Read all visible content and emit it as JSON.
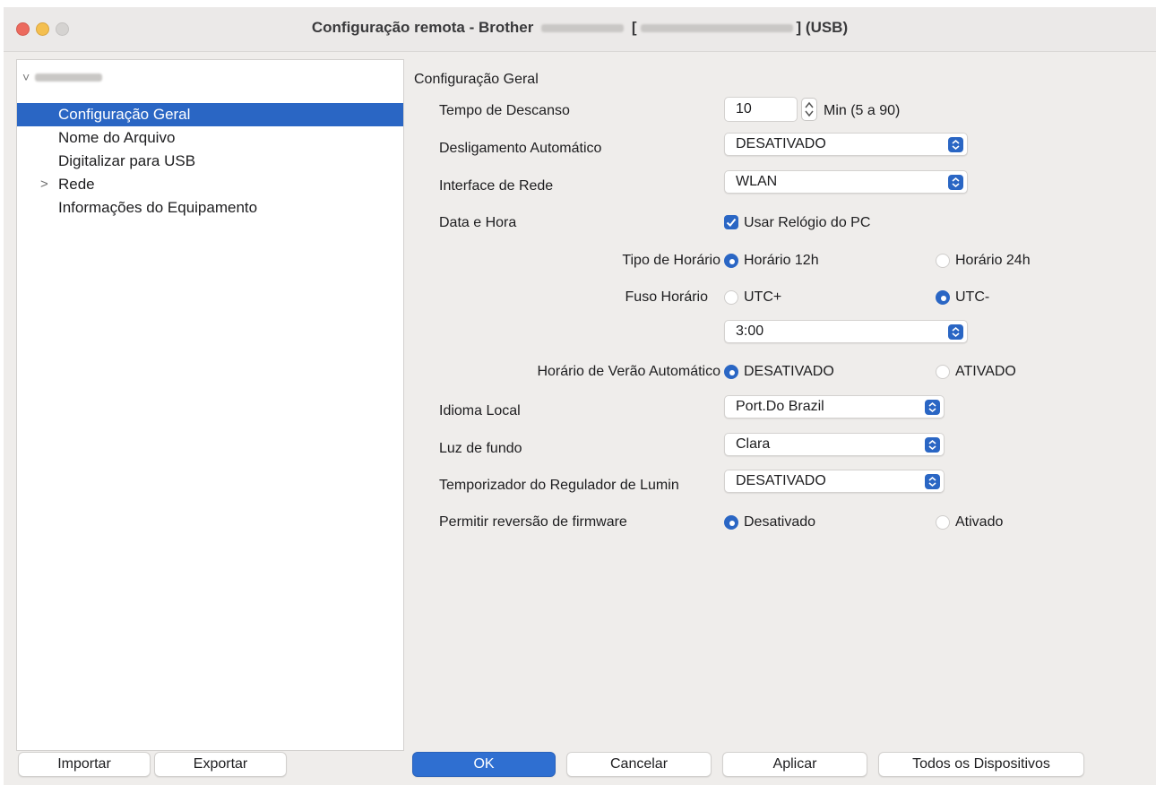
{
  "window": {
    "title_prefix": "Configuração remota - Brother",
    "title_bracket_open": "[",
    "title_bracket_close": "]",
    "title_suffix": "(USB)"
  },
  "sidebar": {
    "items": [
      {
        "label": "Configuração Geral",
        "selected": true
      },
      {
        "label": "Nome do Arquivo"
      },
      {
        "label": "Digitalizar para USB"
      },
      {
        "label": "Rede",
        "expandable": true
      },
      {
        "label": "Informações do Equipamento"
      }
    ],
    "rede_chevron": ">",
    "root_chevron": "˅"
  },
  "main": {
    "section_title": "Configuração Geral",
    "sleep_time": {
      "label": "Tempo de Descanso",
      "value": "10",
      "unit": "Min (5 a 90)"
    },
    "auto_power_off": {
      "label": "Desligamento Automático",
      "value": "DESATIVADO"
    },
    "network_interface": {
      "label": "Interface de Rede",
      "value": "WLAN"
    },
    "date_time": {
      "label": "Data e Hora",
      "use_pc_clock_label": "Usar Relógio do PC",
      "use_pc_clock": true
    },
    "clock_type": {
      "label": "Tipo de Horário",
      "option_12": "Horário 12h",
      "option_24": "Horário 24h",
      "selected": "12h"
    },
    "time_zone": {
      "label": "Fuso Horário",
      "option_plus": "UTC+",
      "option_minus": "UTC-",
      "selected": "UTC-",
      "offset": "3:00"
    },
    "dst": {
      "label": "Horário de Verão Automático",
      "option_off": "DESATIVADO",
      "option_on": "ATIVADO",
      "selected": "DESATIVADO"
    },
    "local_language": {
      "label": "Idioma Local",
      "value": "Port.Do Brazil"
    },
    "backlight": {
      "label": "Luz de fundo",
      "value": "Clara"
    },
    "dimmer_timer": {
      "label": "Temporizador do Regulador de Lumin",
      "value": "DESATIVADO"
    },
    "firmware_rollback": {
      "label": "Permitir reversão de firmware",
      "option_off": "Desativado",
      "option_on": "Ativado",
      "selected": "Desativado"
    }
  },
  "footer": {
    "import_label": "Importar",
    "export_label": "Exportar",
    "ok_label": "OK",
    "cancel_label": "Cancelar",
    "apply_label": "Aplicar",
    "all_devices_label": "Todos os Dispositivos"
  },
  "colors": {
    "accent": "#2a66c4",
    "window_bg": "#efedeb",
    "close": "#ec6a5e",
    "minimize": "#f4bf4f"
  }
}
